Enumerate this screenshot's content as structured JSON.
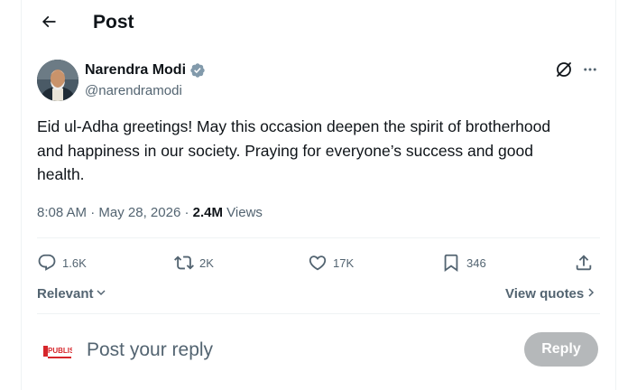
{
  "header": {
    "title": "Post",
    "back_icon": "arrow-left-icon"
  },
  "post": {
    "author": {
      "name": "Narendra Modi",
      "handle": "@narendramodi",
      "verified": true
    },
    "text": "Eid ul-Adha greetings! May this occasion deepen the spirit of brotherhood and happiness in our society. Praying for everyone’s success and good health.",
    "time": "8:08 AM",
    "date": "May 28, 2026",
    "views_count": "2.4M",
    "views_label": "Views",
    "separator": "·"
  },
  "actions": {
    "replies": "1.6K",
    "reposts": "2K",
    "likes": "17K",
    "bookmarks": "346"
  },
  "replies_bar": {
    "sort_label": "Relevant",
    "quotes_label": "View quotes"
  },
  "composer": {
    "avatar_text": "PUBLISH",
    "placeholder": "Post your reply",
    "button_label": "Reply"
  },
  "colors": {
    "text": "#0f1419",
    "muted": "#536471",
    "border": "#eff3f4",
    "verified_badge": "#829aab",
    "reply_button": "#8f9396",
    "brand_red": "#d6262b"
  }
}
